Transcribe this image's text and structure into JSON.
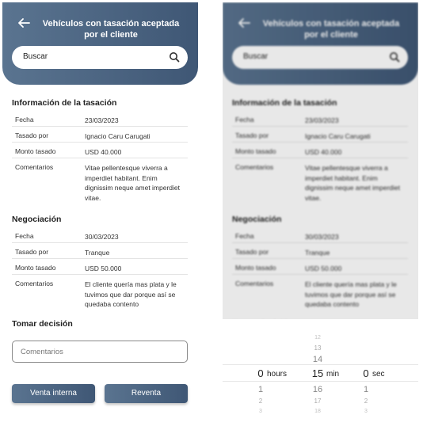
{
  "header": {
    "title": "Vehículos con tasación aceptada por el cliente",
    "search_placeholder": "Buscar"
  },
  "tasacion": {
    "title": "Información de la tasación",
    "rows": [
      {
        "label": "Fecha",
        "value": "23/03/2023"
      },
      {
        "label": "Tasado por",
        "value": "Ignacio Caru Carugati"
      },
      {
        "label": "Monto tasado",
        "value": "USD 40.000"
      },
      {
        "label": "Comentarios",
        "value": "Vitae pellentesque viverra a imperdiet habitant. Enim dignissim neque amet imperdiet vitae."
      }
    ]
  },
  "negociacion": {
    "title": "Negociación",
    "rows": [
      {
        "label": "Fecha",
        "value": "30/03/2023"
      },
      {
        "label": "Tasado por",
        "value": "Tranque"
      },
      {
        "label": "Monto tasado",
        "value": "USD 50.000"
      },
      {
        "label": "Comentarios",
        "value": "El cliente quería mas plata y le tuvimos que dar porque así se quedaba contento"
      }
    ]
  },
  "decision": {
    "title": "Tomar decisión",
    "comentarios_placeholder": "Comentarios",
    "buttons": {
      "venta_interna": "Venta interna",
      "reventa": "Reventa"
    }
  },
  "picker": {
    "hours": {
      "above": [
        "",
        ""
      ],
      "selected": "0",
      "unit": "hours",
      "below": [
        "1",
        "2",
        "3"
      ]
    },
    "minutes": {
      "above": [
        "12",
        "13",
        "14"
      ],
      "selected": "15",
      "unit": "min",
      "below": [
        "16",
        "17",
        "18"
      ]
    },
    "seconds": {
      "above": [
        "",
        ""
      ],
      "selected": "0",
      "unit": "sec",
      "below": [
        "1",
        "2",
        "3"
      ]
    }
  },
  "colors": {
    "header_start": "#5a7490",
    "header_end": "#3f5775"
  }
}
